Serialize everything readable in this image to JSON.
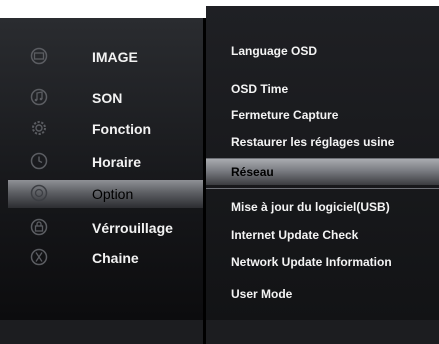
{
  "left_menu": {
    "items": [
      {
        "label": "IMAGE",
        "icon": "image-icon",
        "selected": false
      },
      {
        "label": "SON",
        "icon": "music-note-icon",
        "selected": false
      },
      {
        "label": "Fonction",
        "icon": "gear-icon",
        "selected": false
      },
      {
        "label": "Horaire",
        "icon": "clock-icon",
        "selected": false
      },
      {
        "label": "Option",
        "icon": "option-disc-icon",
        "selected": true
      },
      {
        "label": "Vérrouillage",
        "icon": "lock-icon",
        "selected": false
      },
      {
        "label": "Chaine",
        "icon": "antenna-icon",
        "selected": false
      }
    ]
  },
  "right_menu": {
    "items": [
      {
        "label": "Language  OSD",
        "selected": false
      },
      {
        "label": "OSD Time",
        "selected": false
      },
      {
        "label": "Fermeture Capture",
        "selected": false
      },
      {
        "label": "Restaurer les réglages usine",
        "selected": false
      },
      {
        "label": "Réseau",
        "selected": true
      },
      {
        "label": "Mise à jour du logiciel(USB)",
        "selected": false
      },
      {
        "label": "Internet Update Check",
        "selected": false
      },
      {
        "label": "Network Update Information",
        "selected": false
      },
      {
        "label": "User Mode",
        "selected": false
      }
    ]
  },
  "colors": {
    "text": "#f2f2f2",
    "selected_text": "#000000",
    "icon_stroke": "#5b5d62"
  }
}
